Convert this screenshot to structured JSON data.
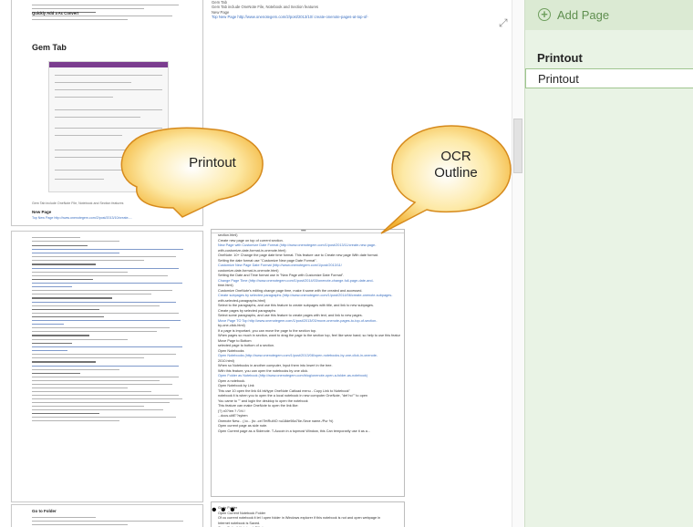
{
  "page_pane": {
    "add_page_label": "Add Page",
    "add_icon": "plus-circle-icon",
    "pages": [
      {
        "title": "Printout",
        "bold": true
      },
      {
        "title": "Printout",
        "selected": true
      }
    ]
  },
  "callouts": {
    "printout": "Printout",
    "ocr_line1": "OCR",
    "ocr_line2": "Outline"
  },
  "printout": {
    "intro_lines": [
      "Quickly Add a Ac Convert",
      "Gem Tab"
    ],
    "figure_caption": "Gem Tab include OneNote File, Notebook and Section features",
    "new_page_heading": "New Page",
    "new_page_link": "Top New Page http://www.onenotegem.com/2/post/2013/10/create-...",
    "section_headings": [
      "New Page with Customize Date Format",
      "Customize New Page Date Format",
      "Change Page Time",
      "Create subpages by selected paragraphs",
      "Create pages by selected paragraphs",
      "Move Page To Top",
      "Move Page to Bottom",
      "Open Notebooks",
      "Open Folder as Notebook",
      "Open Notebook by Link",
      "Open current page as side note",
      "Go to Folder"
    ]
  },
  "top_text": {
    "lines": [
      "Gem Tab",
      "Gem Tab include OneNote File, Notebook and Section features",
      "New Page",
      "Top New Page http://www.onenotegem.com/2/post/2013/10/ create-onenote-pages-at-top-of-"
    ]
  },
  "ocr_outline": {
    "lines": [
      "section.html)",
      "Create new page on top of current section.",
      "New Page with Customize Date Format (http://www.onenotegem.com/1/post/2013/11/create-new-page-",
      "with-customize-date-format-in-onenote.html)",
      "OneNote: 10+ Change the page date time format. This feature use to Create new page With date format.",
      "Setting the date format use \"Customize New page Date Format\".",
      "Customize New Page Date Format (http://www.onenotegem.com/1/post/2013/11/",
      "customize-date-format-in-onenote.html)",
      "Setting the Date and Time format use in \"New Page with Customize Date Format\".",
      "Change Page Time (http://www.onenotegem.com/1/post/2014/03/onenote-change-full-page-date-and-",
      "time.html)",
      "Customize OneNote's editing change page time, make it same with the created and accessed.",
      "Create subpages by selected paragraphs (http://www.onenotegem.com/1/post/2014/06/create-onenote-subpages-",
      "with-selected-paragraphs.html)",
      "Select to the paragraphs, and use this feature to create subpages with title, and link to new subpages.",
      "Create pages by selected paragraphs",
      "Select some paragraphs, and use this feature to create pages with text, and link to new pages.",
      "Move Page TO Top http://www.onenotegem.com/1/post/2013/03/move-onenote-pages-to-top-of-section-",
      "by-one-click.html)",
      "If a page is important, you can move the page to the section top.",
      "When pages so much in section, want to drag the page to the section top, feel like wear hand; so help to use this feature to top it.",
      "Move Page to Bottom",
      "selected page to bottom of a section.",
      "Open Notebooks",
      "Open Notebooks (http://www.onenotegem.com/1/post/2013/08/open-notebooks-by-one-click-in-onenote-",
      "2010.html)",
      "When so Notebooks in another computer, Input them into Insert in the tree.",
      "With this feature, you can open the notebooks by one click.",
      "Open Folder as Notebook (http://www.onenotegem.com/blog/onenote-open-a-folder-as-notebook)",
      "Open a notebook.",
      "Open Notebook by Link",
      "This use 10 open the link 64 bit/type OneNote Catload menu - Copy Link to Notebook\"",
      "notebook it is when you to open the a local notebook in new computer OneNote, \"def ho\"\" to open",
      "You came to \"\" and login the desktop to open the notebook",
      "This feature can make OneNote to open the link like:",
      "(?) x0?/ee.? /?/d /",
      "...docs.uiitE'?sytem",
      "Onenote New... (.to... (to -cel TetRuMO nu18de98a76e-Sece name-/Pur %)",
      "Open current page as side note.",
      "Open Current page as a Sidenote. T-Accoin in a topmost Window, this Can temporarily use it as a..."
    ],
    "bottom_lines": [
      "Go to Folder",
      "Open Current Notebook Folder",
      "Of cu current notebook it let I open folder in Windows explorer if this notebook is not and open webpage in",
      "Internet notebook is Saved.",
      "Open Default Notebook Fill sto"
    ]
  }
}
